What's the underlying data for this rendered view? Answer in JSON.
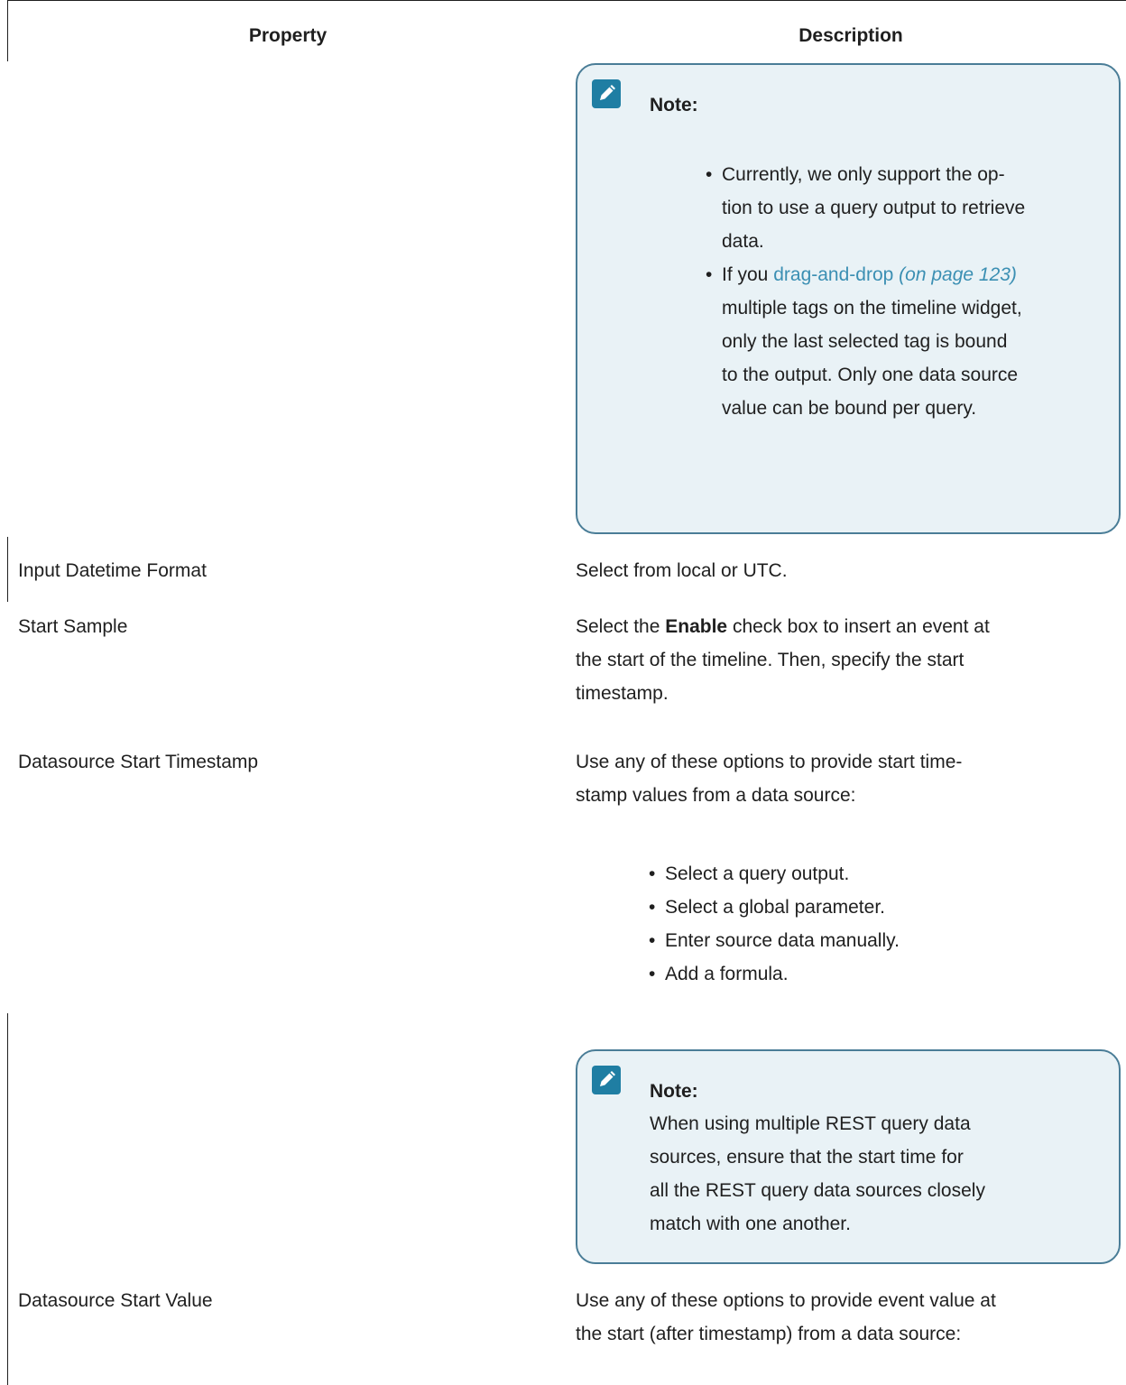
{
  "table": {
    "headers": {
      "property": "Property",
      "description": "Description"
    },
    "note1": {
      "title": "Note:",
      "bullet1": "Currently, we only support the op-tion to use a query output to retrieve data.",
      "bullet1_lines": [
        "Currently, we only support the op-",
        "tion to use a query output to retrieve",
        "data."
      ],
      "bullet2_prefix": "If you",
      "bullet2_link": "drag-and-drop",
      "bullet2_ref": "(on page 123)",
      "bullet2_lines": [
        "multiple tags on the timeline widget,",
        "only the last selected tag is bound",
        "to the output. Only one data source",
        "value can be bound per query."
      ]
    },
    "rows": [
      {
        "property": "Input Datetime Format",
        "description": "Select from local or UTC."
      },
      {
        "property": "Start Sample",
        "desc_prefix": "Select the",
        "desc_bold": "Enable",
        "desc_suffix": "check box to insert an event at",
        "desc_lines": [
          "the start of the timeline. Then, specify the start",
          "timestamp."
        ]
      },
      {
        "property": "Datasource Start Timestamp",
        "desc_lines": [
          "Use any of these options to provide start time-",
          "stamp values from a data source:"
        ],
        "options": [
          "Select a query output.",
          "Select a global parameter.",
          "Enter source data manually.",
          "Add a formula."
        ],
        "note": {
          "title": "Note:",
          "lines": [
            "When using multiple REST query data",
            "sources, ensure that the start time for",
            "all the REST query data sources closely",
            "match with one another."
          ]
        }
      },
      {
        "property": "Datasource Start Value",
        "desc_lines": [
          "Use any of these options to provide event value at",
          "the start (after timestamp) from a data source:"
        ]
      }
    ]
  },
  "colors": {
    "note_border": "#4a7d97",
    "note_bg": "#e9f2f6",
    "icon_bg": "#1f7ea3",
    "link": "#3b8fb3"
  },
  "icons": {
    "note_icon": "pencil-note-icon"
  }
}
